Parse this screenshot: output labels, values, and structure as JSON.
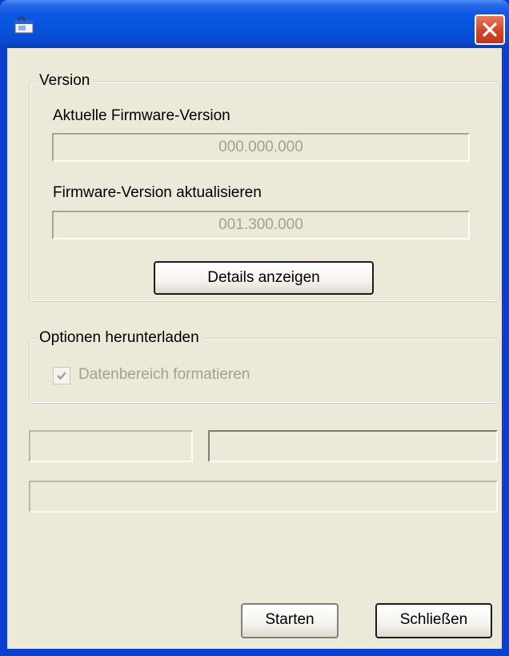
{
  "window": {
    "title": "",
    "close_icon": "close-icon",
    "app_icon": "application-icon"
  },
  "version_group": {
    "legend": "Version",
    "current_label": "Aktuelle Firmware-Version",
    "current_value": "000.000.000",
    "update_label": "Firmware-Version aktualisieren",
    "update_value": "001.300.000",
    "details_button": "Details anzeigen"
  },
  "options_group": {
    "legend": "Optionen herunterladen",
    "format_checkbox_label": "Datenbereich formatieren",
    "format_checked": true
  },
  "footer": {
    "start_button": "Starten",
    "close_button": "Schließen"
  }
}
